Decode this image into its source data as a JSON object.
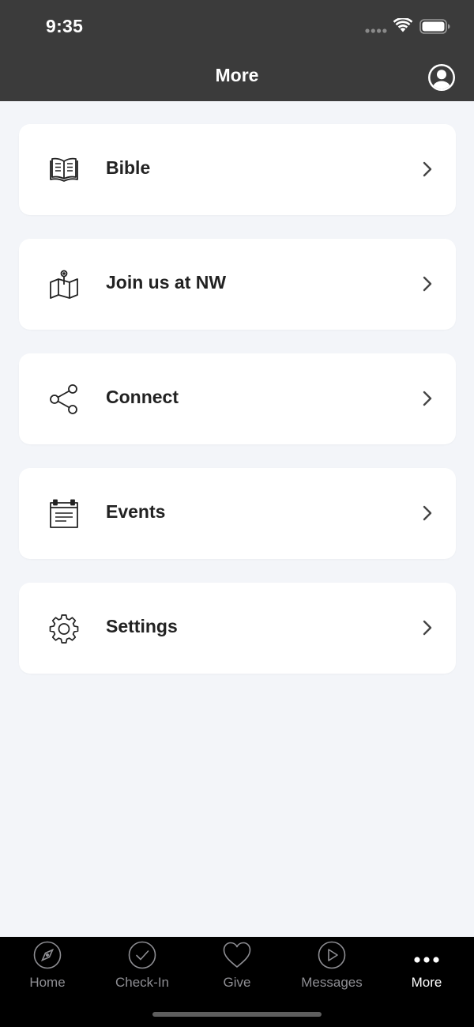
{
  "status_bar": {
    "time": "9:35",
    "signal_icon": "signal-dots-icon",
    "wifi_icon": "wifi-icon",
    "battery_icon": "battery-icon"
  },
  "header": {
    "title": "More",
    "profile_icon": "user-avatar-icon"
  },
  "menu": {
    "items": [
      {
        "label": "Bible",
        "icon": "open-book-icon"
      },
      {
        "label": "Join us at NW",
        "icon": "map-pin-icon"
      },
      {
        "label": "Connect",
        "icon": "share-icon"
      },
      {
        "label": "Events",
        "icon": "calendar-icon"
      },
      {
        "label": "Settings",
        "icon": "gear-icon"
      }
    ]
  },
  "tabbar": {
    "tabs": [
      {
        "label": "Home",
        "icon": "compass-icon",
        "active": false
      },
      {
        "label": "Check-In",
        "icon": "checkmark-circle-icon",
        "active": false
      },
      {
        "label": "Give",
        "icon": "heart-icon",
        "active": false
      },
      {
        "label": "Messages",
        "icon": "play-circle-icon",
        "active": false
      },
      {
        "label": "More",
        "icon": "more-dots-icon",
        "active": true
      }
    ]
  },
  "colors": {
    "header_bg": "#3b3b3b",
    "page_bg": "#f3f5f9",
    "card_bg": "#ffffff",
    "tabbar_bg": "#000000",
    "tab_inactive": "#8e8e93",
    "tab_active": "#ffffff"
  }
}
